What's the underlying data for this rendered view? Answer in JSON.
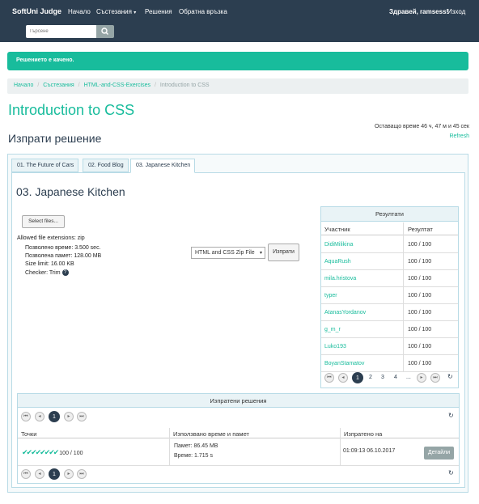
{
  "nav": {
    "brand": "SoftUni Judge",
    "home": "Начало",
    "contests": "Състезания",
    "contests_caret": "▾",
    "submissions": "Решения",
    "feedback": "Обратна връзка",
    "greeting": "Здравей, ramsess!",
    "logout": "Изход",
    "search_placeholder": "Търсене"
  },
  "alert": {
    "text": "Решението е качено."
  },
  "breadcrumb": {
    "items": [
      "Начало",
      "Състезания",
      "HTML-and-CSS-Exercises"
    ],
    "active": "Introduction to CSS",
    "sep": "/"
  },
  "page": {
    "title": "Introduction to CSS",
    "subtitle": "Изпрати решение",
    "time_left": "Оставащо време 46 ч, 47 м и 45 сек",
    "refresh": "Refresh"
  },
  "tabs": [
    {
      "label": "01. The Future of Cars"
    },
    {
      "label": "02. Food Blog"
    },
    {
      "label": "03. Japanese Kitchen"
    }
  ],
  "problem": {
    "title": "03. Japanese Kitchen",
    "select_files": "Select files...",
    "allowed_ext": "Allowed file extensions: zip",
    "time_limit": "Позволено време: 3.500 sec.",
    "memory_limit": "Позволена памет: 128.00 MB",
    "size_limit": "Size limit: 16.00 KB",
    "checker": "Checker: Trim",
    "help_glyph": "?",
    "strategy": "HTML and CSS Zip File",
    "strategy_caret": "▾",
    "submit": "Изпрати"
  },
  "results": {
    "title": "Резултати",
    "col_user": "Участник",
    "col_result": "Резултат",
    "rows": [
      {
        "user": "DidiMilikina",
        "score": "100 / 100"
      },
      {
        "user": "AquaRush",
        "score": "100 / 100"
      },
      {
        "user": "mila.hristova",
        "score": "100 / 100"
      },
      {
        "user": "typer",
        "score": "100 / 100"
      },
      {
        "user": "AtanasYordanov",
        "score": "100 / 100"
      },
      {
        "user": "g_m_r",
        "score": "100 / 100"
      },
      {
        "user": "Luko193",
        "score": "100 / 100"
      },
      {
        "user": "BoyanStamatov",
        "score": "100 / 100"
      }
    ],
    "pager": {
      "pages": [
        "1",
        "2",
        "3",
        "4",
        "..."
      ],
      "current": "1",
      "first": "⏮",
      "prev": "◂",
      "next": "▸",
      "last": "⏭",
      "refresh": "↻"
    }
  },
  "submissions": {
    "title": "Изпратени решения",
    "col_points": "Точки",
    "col_resources": "Използвано време и памет",
    "col_sent": "Изпратено на",
    "row": {
      "checks": "✔✔✔✔✔✔✔✔",
      "points": "100 / 100",
      "memory": "Памет: 86.45 MB",
      "time": "Време: 1.715 s",
      "sent": "01:09:13 06.10.2017",
      "details": "Детайли"
    },
    "pager": {
      "current": "1",
      "first": "⏮",
      "prev": "◂",
      "next": "▸",
      "last": "⏭",
      "refresh": "↻"
    }
  },
  "colors": {
    "accent": "#18bc9c",
    "navbar": "#2c3e50"
  }
}
